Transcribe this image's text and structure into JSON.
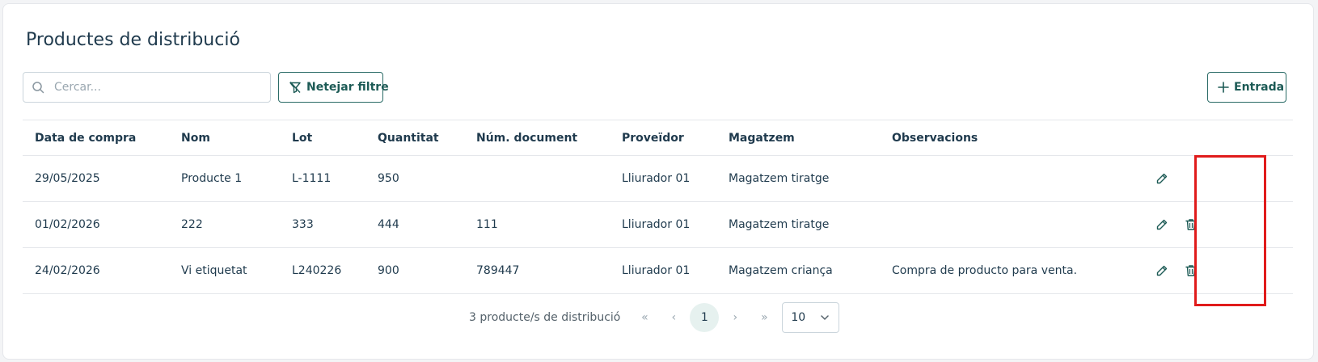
{
  "page": {
    "title": "Productes de distribució"
  },
  "toolbar": {
    "search_placeholder": "Cercar...",
    "search_value": "",
    "clear_filter_label": "Netejar filtre",
    "add_entry_label": "Entrada"
  },
  "table": {
    "columns": [
      "Data de compra",
      "Nom",
      "Lot",
      "Quantitat",
      "Núm. document",
      "Proveïdor",
      "Magatzem",
      "Observacions"
    ],
    "rows": [
      {
        "date": "29/05/2025",
        "name": "Producte 1",
        "lot": "L-1111",
        "quantity": "950",
        "document": "",
        "supplier": "Lliurador 01",
        "warehouse": "Magatzem tiratge",
        "notes": "",
        "can_delete": false
      },
      {
        "date": "01/02/2026",
        "name": "222",
        "lot": "333",
        "quantity": "444",
        "document": "111",
        "supplier": "Lliurador 01",
        "warehouse": "Magatzem tiratge",
        "notes": "",
        "can_delete": true
      },
      {
        "date": "24/02/2026",
        "name": "Vi etiquetat",
        "lot": "L240226",
        "quantity": "900",
        "document": "789447",
        "supplier": "Lliurador 01",
        "warehouse": "Magatzem criança",
        "notes": "Compra de producto para venta.",
        "can_delete": true
      }
    ],
    "row_icons": {
      "edit": "pencil-icon",
      "delete": "trash-icon"
    }
  },
  "pagination": {
    "count_label": "3 producte/s de distribució",
    "first": "«",
    "prev": "‹",
    "current_page": "1",
    "next": "›",
    "last": "»",
    "page_size": "10"
  },
  "colors": {
    "accent": "#1c5a55",
    "text": "#1f3a4d",
    "highlight": "#e01b1b"
  }
}
